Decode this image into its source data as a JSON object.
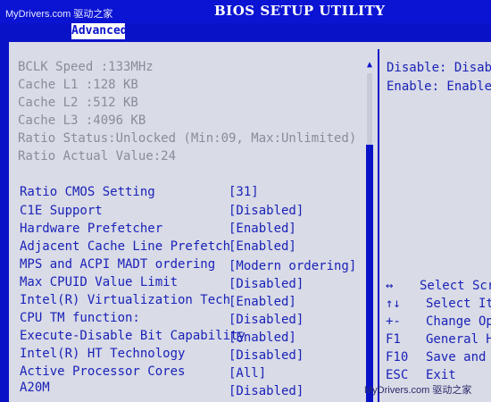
{
  "watermark": "MyDrivers.com 驱动之家",
  "header": {
    "title": "BIOS SETUP UTILITY"
  },
  "tabs": [
    {
      "label": "Advanced",
      "active": true
    }
  ],
  "info": [
    "BCLK Speed  :133MHz",
    "Cache L1    :128 KB",
    "Cache L2    :512 KB",
    "Cache L3    :4096 KB",
    "Ratio Status:Unlocked (Min:09, Max:Unlimited)",
    "Ratio Actual Value:24"
  ],
  "settings": [
    {
      "label": "Ratio CMOS Setting",
      "value": "[31]"
    },
    {
      "label": "C1E Support",
      "value": "[Disabled]"
    },
    {
      "label": "Hardware Prefetcher",
      "value": "[Enabled]"
    },
    {
      "label": "Adjacent Cache Line Prefetch",
      "value": "[Enabled]"
    },
    {
      "label": "MPS and ACPI MADT ordering",
      "value": "[Modern ordering]"
    },
    {
      "label": "Max CPUID Value Limit",
      "value": "[Disabled]"
    },
    {
      "label": "Intel(R) Virtualization Tech",
      "value": "[Enabled]"
    },
    {
      "label": "CPU TM function:",
      "value": "[Disabled]"
    },
    {
      "label": "Execute-Disable Bit Capability",
      "value": "[Enabled]"
    },
    {
      "label": "Intel(R) HT Technology",
      "value": "[Disabled]"
    },
    {
      "label": "Active Processor Cores",
      "value": "[All]"
    },
    {
      "label": "A20M",
      "value": "[Disabled]"
    }
  ],
  "help": [
    "Disable: Disable",
    "Enable:  Enable"
  ],
  "keys": [
    {
      "key": "↔",
      "desc": "Select Scre"
    },
    {
      "key": "↑↓",
      "desc": "Select Ite"
    },
    {
      "key": "+-",
      "desc": "Change Opt"
    },
    {
      "key": "F1",
      "desc": "General He"
    },
    {
      "key": "F10",
      "desc": "Save and E"
    },
    {
      "key": "ESC",
      "desc": "Exit"
    }
  ],
  "colors": {
    "background": "#0a12c8",
    "panel": "#d9dbe6",
    "text": "#1a22b8",
    "info_text": "#8a8c99"
  }
}
